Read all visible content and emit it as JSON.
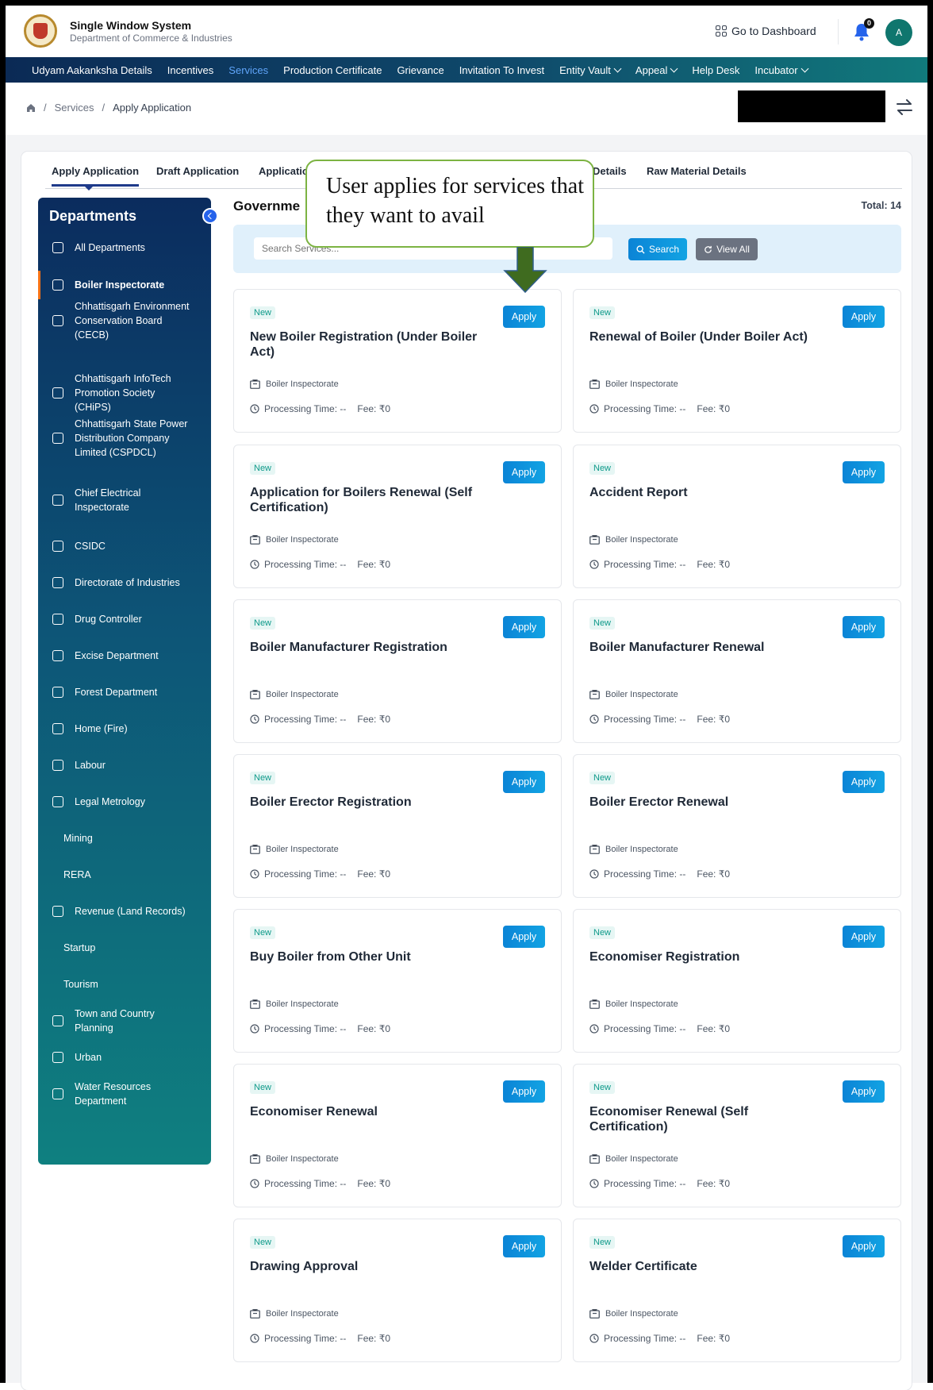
{
  "header": {
    "title": "Single Window System",
    "subtitle": "Department of Commerce & Industries",
    "dashboard_label": "Go to Dashboard",
    "notification_count": "0",
    "avatar_initial": "A"
  },
  "nav": {
    "items": [
      {
        "label": "Udyam Aakanksha Details"
      },
      {
        "label": "Incentives"
      },
      {
        "label": "Services"
      },
      {
        "label": "Production Certificate"
      },
      {
        "label": "Grievance"
      },
      {
        "label": "Invitation To Invest"
      },
      {
        "label": "Entity Vault"
      },
      {
        "label": "Appeal"
      },
      {
        "label": "Help Desk"
      },
      {
        "label": "Incubator"
      }
    ]
  },
  "breadcrumb": {
    "sep": "/",
    "parent": "Services",
    "current": "Apply Application"
  },
  "tabs": [
    {
      "label": "Apply Application"
    },
    {
      "label": "Draft Application"
    },
    {
      "label": "Applicatio"
    },
    {
      "label": "Details"
    },
    {
      "label": "Raw Material Details"
    }
  ],
  "sidebar": {
    "title": "Departments",
    "items": [
      {
        "label": "All Departments"
      },
      {
        "label": "Boiler Inspectorate"
      },
      {
        "label": "Chhattisgarh Environment Conservation Board (CECB)"
      },
      {
        "label": "Chhattisgarh InfoTech Promotion Society (CHiPS)"
      },
      {
        "label": "Chhattisgarh State Power Distribution Company Limited (CSPDCL)"
      },
      {
        "label": "Chief Electrical Inspectorate"
      },
      {
        "label": "CSIDC"
      },
      {
        "label": "Directorate of Industries"
      },
      {
        "label": "Drug Controller"
      },
      {
        "label": "Excise Department"
      },
      {
        "label": "Forest Department"
      },
      {
        "label": "Home (Fire)"
      },
      {
        "label": "Labour"
      },
      {
        "label": "Legal Metrology"
      },
      {
        "label": "Mining"
      },
      {
        "label": "RERA"
      },
      {
        "label": "Revenue (Land Records)"
      },
      {
        "label": "Startup"
      },
      {
        "label": "Tourism"
      },
      {
        "label": "Town and Country Planning"
      },
      {
        "label": "Urban"
      },
      {
        "label": "Water Resources Department"
      }
    ]
  },
  "main": {
    "section_title": "Governme",
    "total": "Total: 14",
    "search_placeholder": "Search Services...",
    "search_label": "Search",
    "view_all_label": "View All"
  },
  "callout": {
    "text": "User applies for services that they want to avail"
  },
  "services": [
    {
      "badge": "New",
      "name": "New Boiler Registration (Under Boiler Act)",
      "dept": "Boiler Inspectorate",
      "time": "Processing Time: --",
      "fee": "Fee: ₹0",
      "apply": "Apply"
    },
    {
      "badge": "New",
      "name": "Renewal of Boiler (Under Boiler Act)",
      "dept": "Boiler Inspectorate",
      "time": "Processing Time: --",
      "fee": "Fee: ₹0",
      "apply": "Apply"
    },
    {
      "badge": "New",
      "name": "Application for Boilers Renewal (Self Certification)",
      "dept": "Boiler Inspectorate",
      "time": "Processing Time: --",
      "fee": "Fee: ₹0",
      "apply": "Apply"
    },
    {
      "badge": "New",
      "name": "Accident Report",
      "dept": "Boiler Inspectorate",
      "time": "Processing Time: --",
      "fee": "Fee: ₹0",
      "apply": "Apply"
    },
    {
      "badge": "New",
      "name": "Boiler Manufacturer Registration",
      "dept": "Boiler Inspectorate",
      "time": "Processing Time: --",
      "fee": "Fee: ₹0",
      "apply": "Apply"
    },
    {
      "badge": "New",
      "name": "Boiler Manufacturer Renewal",
      "dept": "Boiler Inspectorate",
      "time": "Processing Time: --",
      "fee": "Fee: ₹0",
      "apply": "Apply"
    },
    {
      "badge": "New",
      "name": "Boiler Erector Registration",
      "dept": "Boiler Inspectorate",
      "time": "Processing Time: --",
      "fee": "Fee: ₹0",
      "apply": "Apply"
    },
    {
      "badge": "New",
      "name": "Boiler Erector Renewal",
      "dept": "Boiler Inspectorate",
      "time": "Processing Time: --",
      "fee": "Fee: ₹0",
      "apply": "Apply"
    },
    {
      "badge": "New",
      "name": "Buy Boiler from Other Unit",
      "dept": "Boiler Inspectorate",
      "time": "Processing Time: --",
      "fee": "Fee: ₹0",
      "apply": "Apply"
    },
    {
      "badge": "New",
      "name": "Economiser Registration",
      "dept": "Boiler Inspectorate",
      "time": "Processing Time: --",
      "fee": "Fee: ₹0",
      "apply": "Apply"
    },
    {
      "badge": "New",
      "name": "Economiser Renewal",
      "dept": "Boiler Inspectorate",
      "time": "Processing Time: --",
      "fee": "Fee: ₹0",
      "apply": "Apply"
    },
    {
      "badge": "New",
      "name": "Economiser Renewal (Self Certification)",
      "dept": "Boiler Inspectorate",
      "time": "Processing Time: --",
      "fee": "Fee: ₹0",
      "apply": "Apply"
    },
    {
      "badge": "New",
      "name": "Drawing Approval",
      "dept": "Boiler Inspectorate",
      "time": "Processing Time: --",
      "fee": "Fee: ₹0",
      "apply": "Apply"
    },
    {
      "badge": "New",
      "name": "Welder Certificate",
      "dept": "Boiler Inspectorate",
      "time": "Processing Time: --",
      "fee": "Fee: ₹0",
      "apply": "Apply"
    }
  ],
  "colors": {
    "nav_start": "#0b2a55",
    "nav_end": "#117a7c",
    "accent": "#0b84d6",
    "active_nav": "#60a5fa",
    "badge_text": "#0f9a8a",
    "callout_border": "#7cb342",
    "arrow_fill": "#3f6b1f"
  }
}
